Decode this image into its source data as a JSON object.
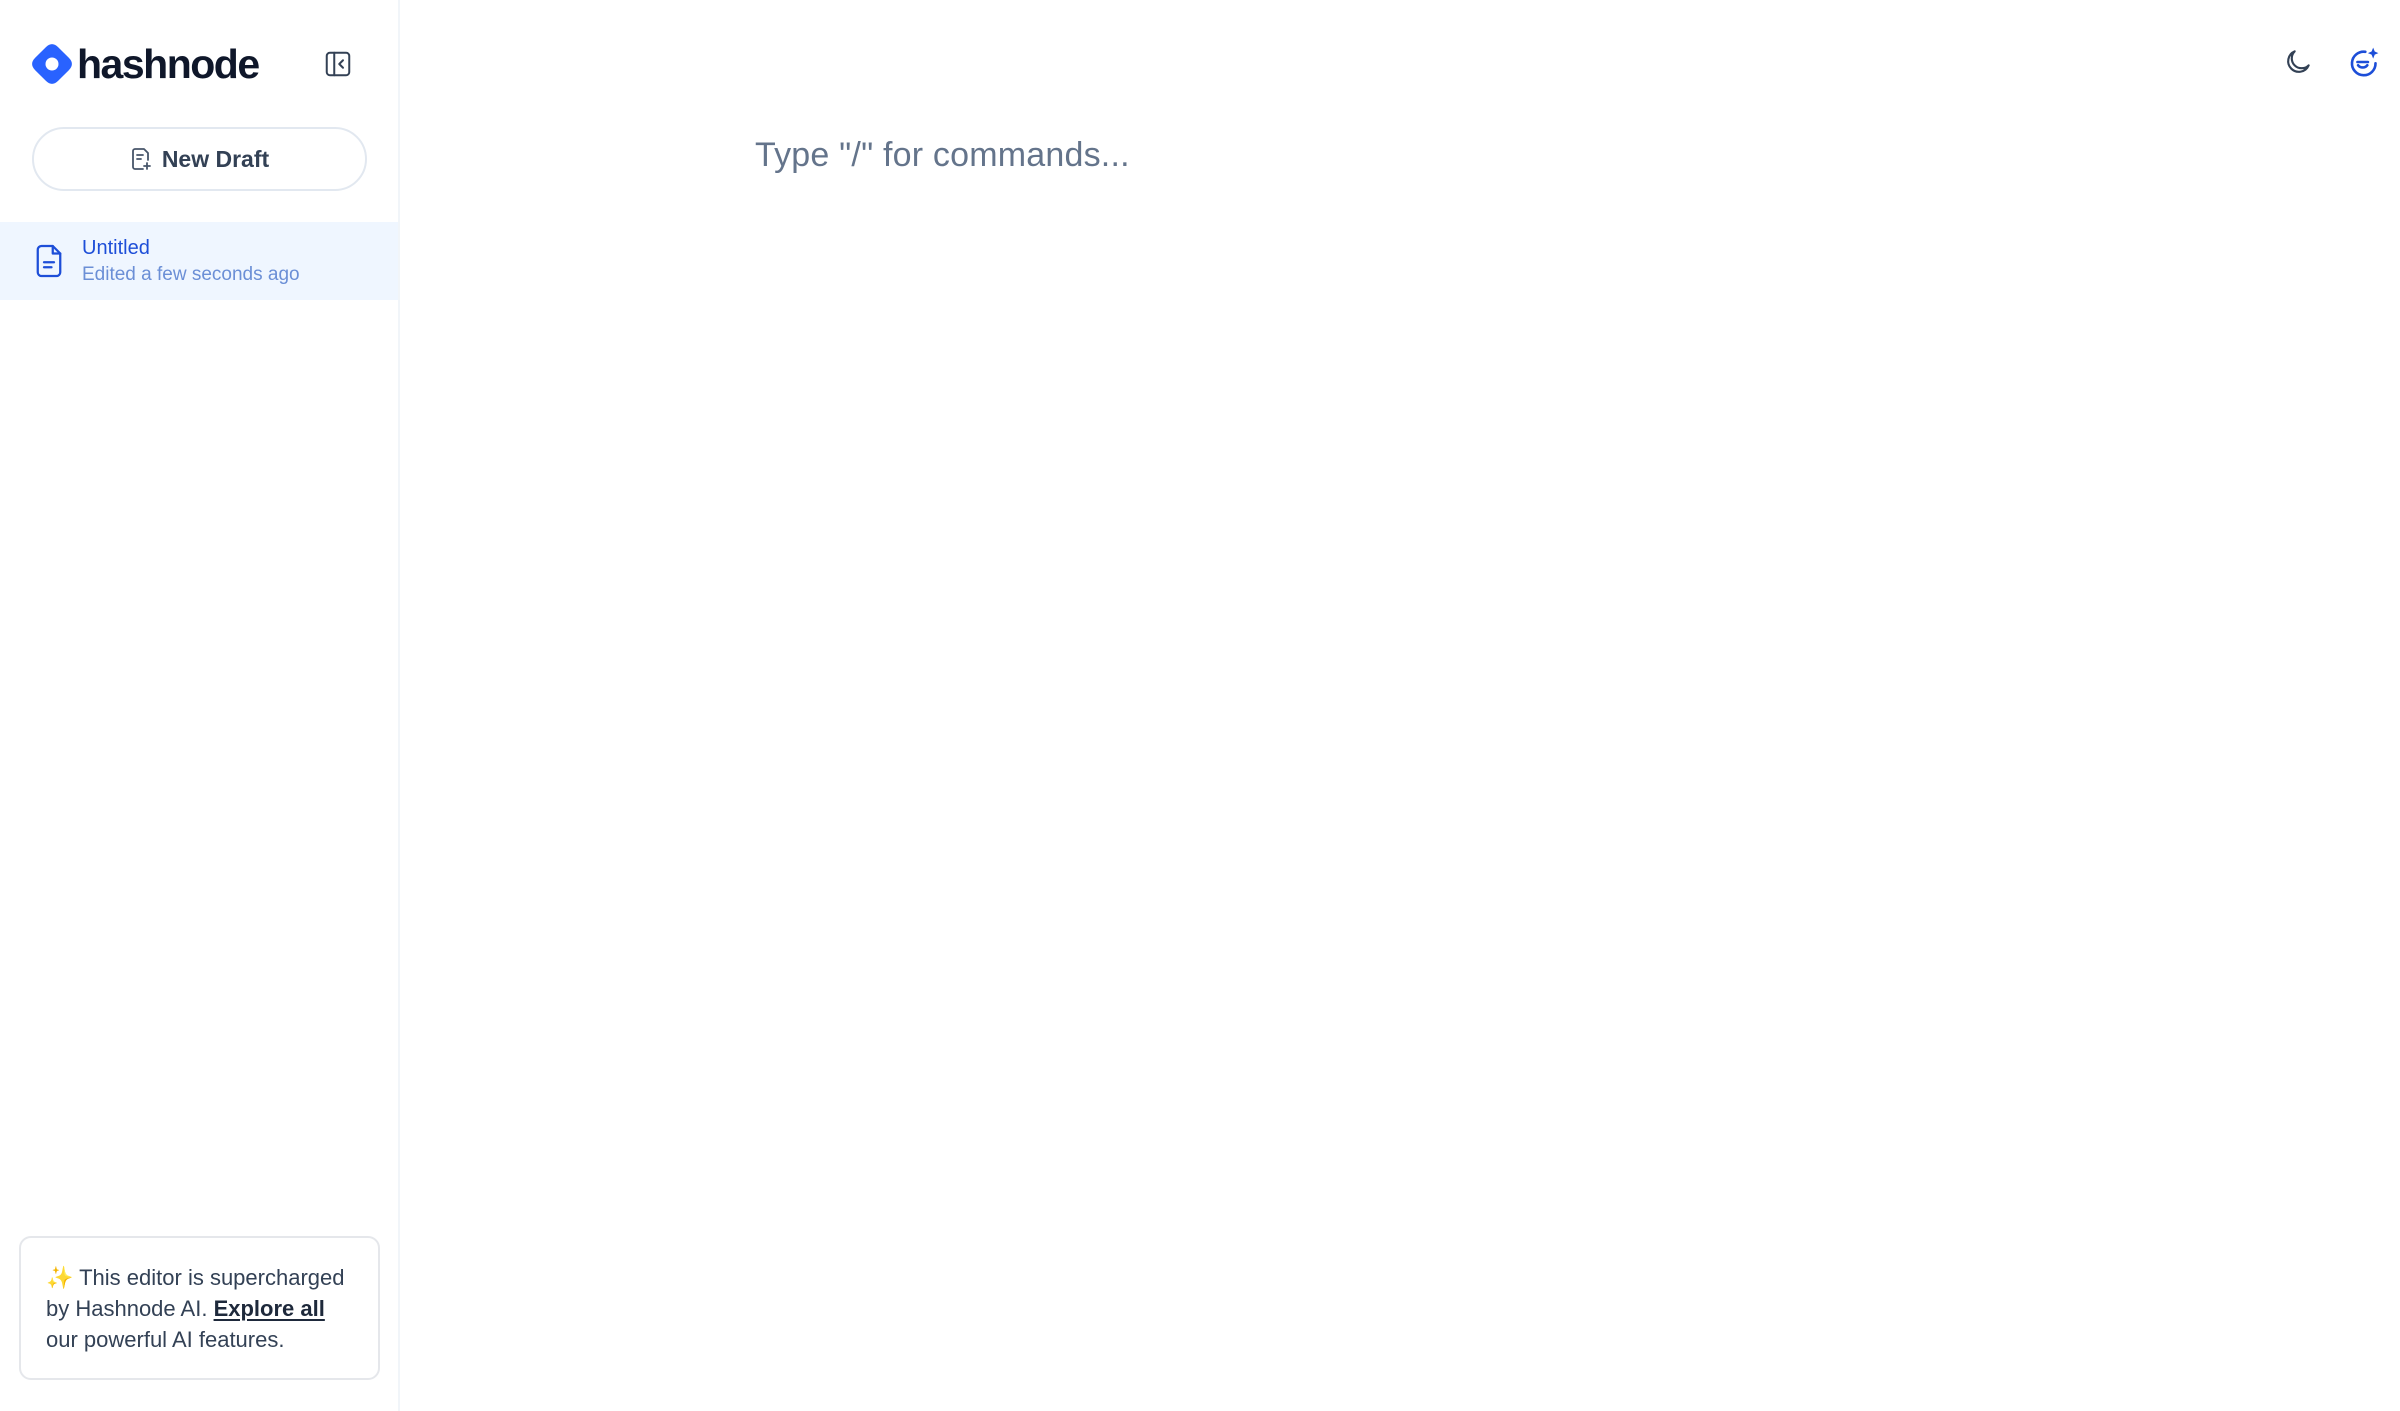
{
  "brand": {
    "name": "hashnode",
    "accent": "#2962ff"
  },
  "sidebar": {
    "collapse_icon": "sidebar-collapse-icon",
    "new_draft_label": "New Draft",
    "drafts": [
      {
        "title": "Untitled",
        "meta": "Edited a few seconds ago",
        "active": true
      }
    ],
    "ai_card": {
      "sparkle": "✨",
      "text_before": " This editor is supercharged by Hashnode AI. ",
      "link": "Explore all",
      "text_after": " our powerful AI features."
    }
  },
  "editor": {
    "placeholder": "Type \"/\" for commands..."
  },
  "topbar": {
    "icons": [
      "moon-icon",
      "ai-assistant-icon"
    ]
  }
}
